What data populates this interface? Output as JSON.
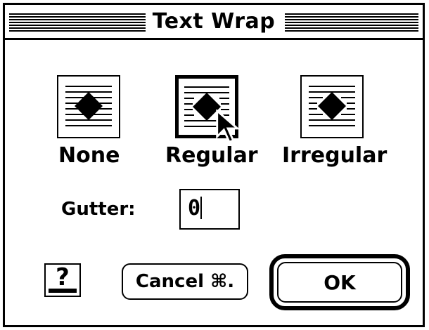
{
  "dialog": {
    "title": "Text Wrap"
  },
  "wrap_options": [
    {
      "label": "None",
      "icon": "wrap-none-icon",
      "selected": false
    },
    {
      "label": "Regular",
      "icon": "wrap-regular-icon",
      "selected": true
    },
    {
      "label": "Irregular",
      "icon": "wrap-irregular-icon",
      "selected": false
    }
  ],
  "gutter": {
    "label": "Gutter:",
    "value": "0"
  },
  "buttons": {
    "help_label": "?",
    "cancel_label": "Cancel ⌘.",
    "ok_label": "OK"
  }
}
